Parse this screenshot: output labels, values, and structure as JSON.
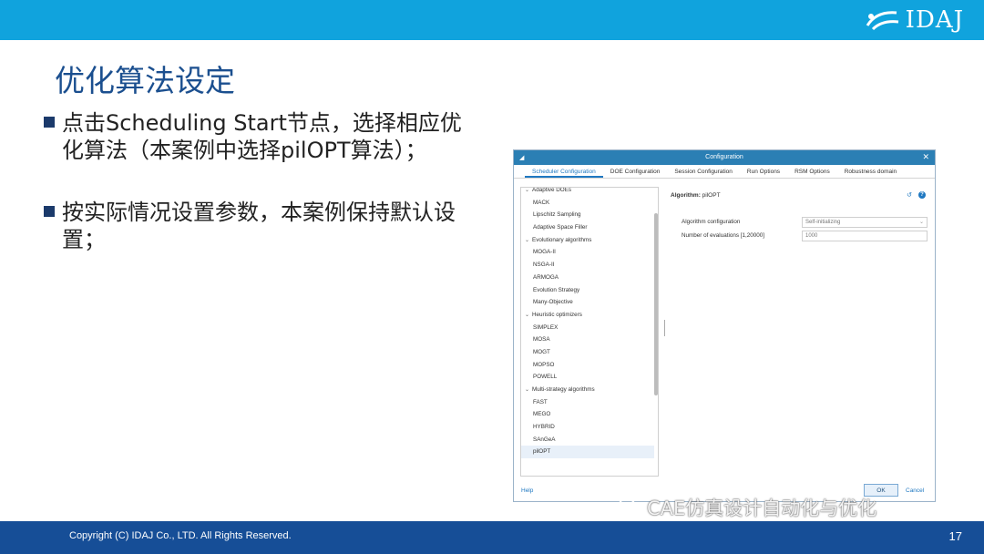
{
  "header": {
    "logo_text": "IDAJ",
    "bar_color": "#10a3dd"
  },
  "slide": {
    "title": "优化算法设定",
    "bullets": [
      "点击Scheduling Start节点，选择相应优化算法（本案例中选择pilOPT算法）；",
      "按实际情况设置参数，本案例保持默认设置；"
    ]
  },
  "dialog": {
    "title": "Configuration",
    "tabs": [
      "Scheduler Configuration",
      "DOE Configuration",
      "Session Configuration",
      "Run Options",
      "RSM Options",
      "Robustness domain"
    ],
    "active_tab": "Scheduler Configuration",
    "list": [
      {
        "label": "Adaptive DOEs",
        "group": true
      },
      {
        "label": "MACK"
      },
      {
        "label": "Lipschitz Sampling"
      },
      {
        "label": "Adaptive Space Filler"
      },
      {
        "label": "Evolutionary algorithms",
        "group": true
      },
      {
        "label": "MOGA-II"
      },
      {
        "label": "NSGA-II"
      },
      {
        "label": "ARMOGA"
      },
      {
        "label": "Evolution Strategy"
      },
      {
        "label": "Many-Objective"
      },
      {
        "label": "Heuristic optimizers",
        "group": true
      },
      {
        "label": "SIMPLEX"
      },
      {
        "label": "MOSA"
      },
      {
        "label": "MOGT"
      },
      {
        "label": "MOPSO"
      },
      {
        "label": "POWELL"
      },
      {
        "label": "Multi-strategy algorithms",
        "group": true
      },
      {
        "label": "FAST"
      },
      {
        "label": "MEGO"
      },
      {
        "label": "HYBRID"
      },
      {
        "label": "SAnGeA"
      },
      {
        "label": "pilOPT",
        "selected": true
      }
    ],
    "algorithm_label": "Algorithm:",
    "algorithm_value": "pilOPT",
    "param_config_label": "Algorithm configuration",
    "param_config_value": "Self-initializing",
    "param_evals_label": "Number of evaluations [1,20000]",
    "param_evals_value": "1000",
    "help": "Help",
    "ok": "OK",
    "cancel": "Cancel"
  },
  "footer": {
    "copyright": "Copyright (C)  IDAJ Co., LTD. All Rights Reserved.",
    "page": "17",
    "color": "#164e97"
  },
  "watermark": "CAE仿真设计自动化与优化"
}
